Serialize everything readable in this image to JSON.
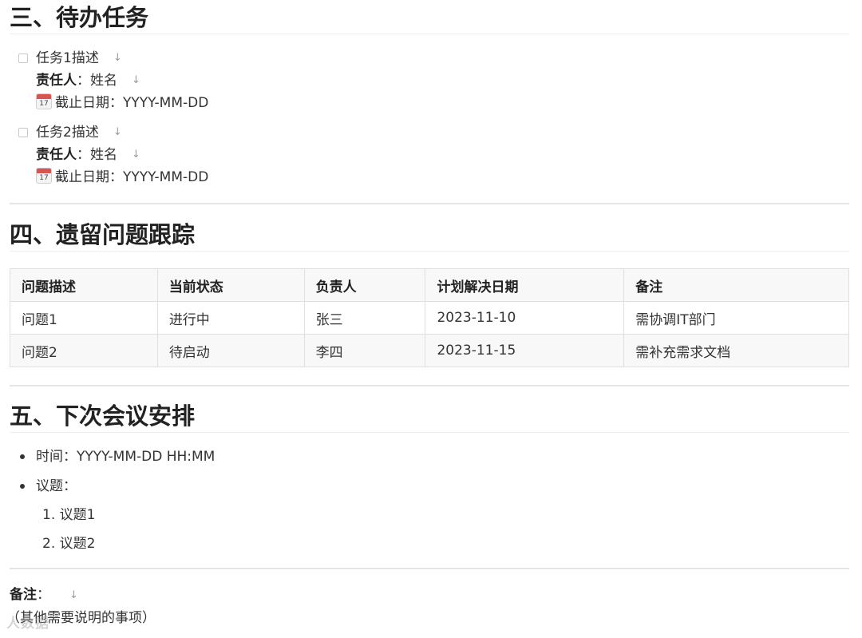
{
  "section3": {
    "title": "三、待办任务",
    "tasks": [
      {
        "description": "任务1描述",
        "owner_label": "责任人",
        "owner_value": "：姓名",
        "date_icon": "calendar-icon",
        "date_icon_day": "17",
        "date_text": "截止日期：YYYY-MM-DD"
      },
      {
        "description": "任务2描述",
        "owner_label": "责任人",
        "owner_value": "：姓名",
        "date_icon": "calendar-icon",
        "date_icon_day": "17",
        "date_text": "截止日期：YYYY-MM-DD"
      }
    ],
    "arrow_glyph": "↓"
  },
  "section4": {
    "title": "四、遗留问题跟踪",
    "table": {
      "headers": [
        "问题描述",
        "当前状态",
        "负责人",
        "计划解决日期",
        "备注"
      ],
      "rows": [
        [
          "问题1",
          "进行中",
          "张三",
          "2023-11-10",
          "需协调IT部门"
        ],
        [
          "问题2",
          "待启动",
          "李四",
          "2023-11-15",
          "需补充需求文档"
        ]
      ]
    }
  },
  "section5": {
    "title": "五、下次会议安排",
    "time_item": "时间：YYYY-MM-DD HH:MM",
    "agenda_label": "议题：",
    "agenda_items": [
      "1.  议题1",
      "2.  议题2"
    ]
  },
  "notes": {
    "label": "备注",
    "colon": "：",
    "arrow_glyph": "↓",
    "text": "（其他需要说明的事项）"
  },
  "watermark": "人数据"
}
